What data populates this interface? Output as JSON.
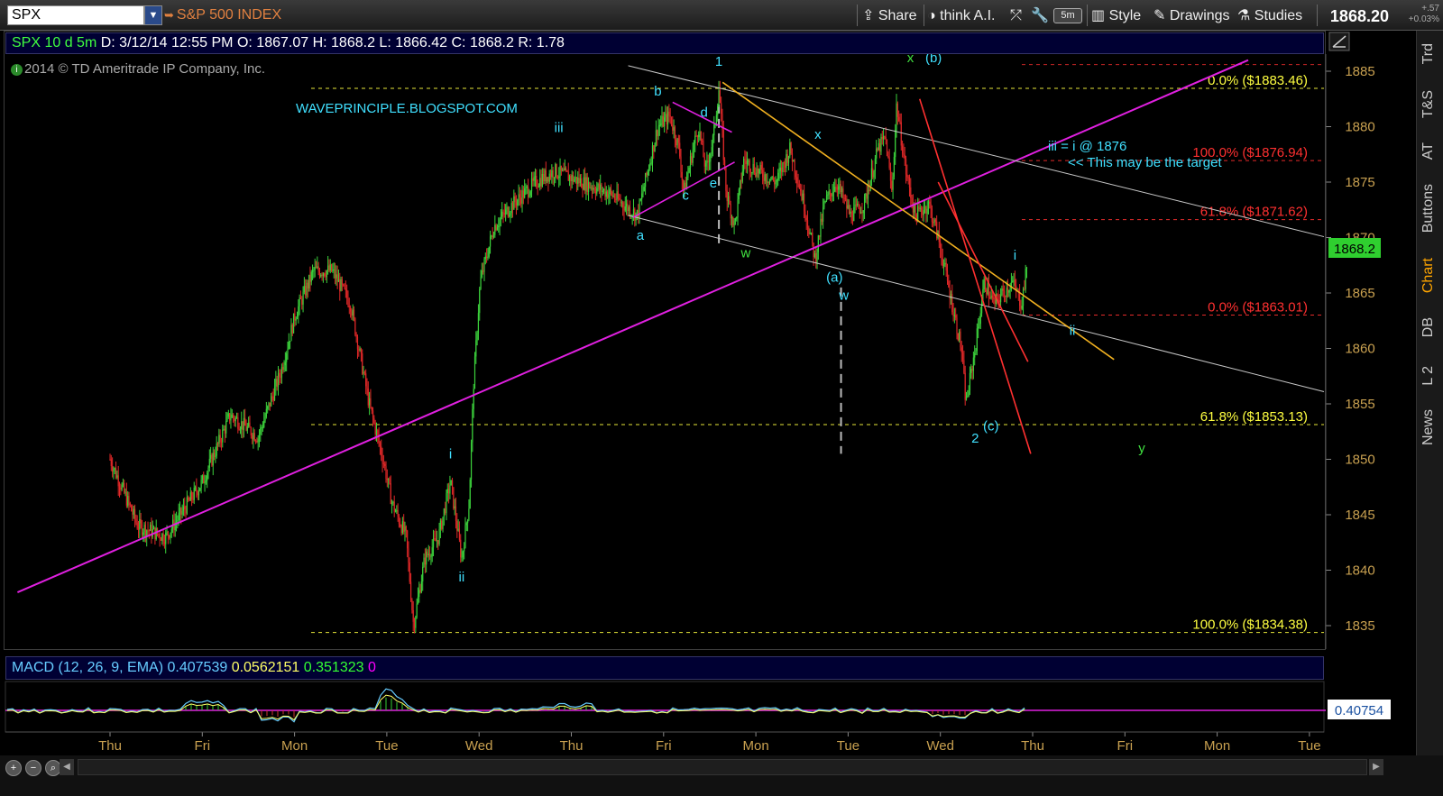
{
  "toolbar": {
    "symbol": "SPX",
    "description": "S&P 500 INDEX",
    "share": "Share",
    "think_ai": "think A.I.",
    "interval": "5m",
    "style": "Style",
    "drawings": "Drawings",
    "studies": "Studies",
    "last_price": "1868.20",
    "change": "+.57",
    "change_pct": "+0.03%"
  },
  "info": {
    "symbol_period": "SPX 10 d 5m",
    "date": "D: 3/12/14 12:55 PM",
    "open": "O: 1867.07",
    "high": "H: 1868.2",
    "low": "L: 1866.42",
    "close": "C: 1868.2",
    "range": "R: 1.78",
    "copyright": "2014 © TD Ameritrade IP Company, Inc."
  },
  "macd": {
    "label": "MACD (12, 26, 9, EMA)",
    "value": "0.407539",
    "avg": "0.0562151",
    "diff": "0.351323",
    "extra": "0",
    "last_tag": "0.40754"
  },
  "right_tabs": [
    "Trd",
    "T&S",
    "AT",
    "Buttons",
    "Chart",
    "DB",
    "L 2",
    "News"
  ],
  "colors": {
    "up": "#3cd23c",
    "down": "#e02828",
    "magenta": "#e020e0",
    "orange": "#f0b020",
    "cyan": "#40e0ff",
    "yellow_fib": "#ffff40",
    "red_fib": "#ff3030",
    "axis_text": "#c8a050"
  },
  "chart_data": [
    {
      "type": "candlestick",
      "title": "SPX 10 d 5m",
      "x_labels": [
        "Thu",
        "Fri",
        "Mon",
        "Tue",
        "Wed",
        "Thu",
        "Fri",
        "Mon",
        "Tue",
        "Wed",
        "Thu",
        "Fri",
        "Mon",
        "Tue"
      ],
      "y_ticks": [
        1835,
        1840,
        1845,
        1850,
        1855,
        1860,
        1865,
        1870,
        1875,
        1880,
        1885
      ],
      "ylim": [
        1832,
        1887
      ],
      "last_price_tag": "1868.2",
      "watermark": "WAVEPRINCIPLE.BLOGSPOT.COM",
      "path_anchors": [
        [
          0.0,
          1850
        ],
        [
          0.3,
          1844
        ],
        [
          0.6,
          1843
        ],
        [
          1.0,
          1848
        ],
        [
          1.3,
          1854
        ],
        [
          1.6,
          1852
        ],
        [
          1.85,
          1858
        ],
        [
          2.0,
          1863
        ],
        [
          2.2,
          1867
        ],
        [
          2.4,
          1867
        ],
        [
          2.6,
          1864
        ],
        [
          2.8,
          1855
        ],
        [
          2.95,
          1850
        ],
        [
          3.05,
          1846
        ],
        [
          3.2,
          1843
        ],
        [
          3.28,
          1835
        ],
        [
          3.4,
          1841
        ],
        [
          3.55,
          1843
        ],
        [
          3.68,
          1848
        ],
        [
          3.8,
          1841
        ],
        [
          3.88,
          1846
        ],
        [
          3.93,
          1857
        ],
        [
          4.0,
          1866
        ],
        [
          4.15,
          1871
        ],
        [
          4.35,
          1873
        ],
        [
          4.6,
          1875
        ],
        [
          4.8,
          1876
        ],
        [
          5.1,
          1875
        ],
        [
          5.4,
          1874
        ],
        [
          5.7,
          1872
        ],
        [
          5.92,
          1880
        ],
        [
          6.05,
          1881
        ],
        [
          6.15,
          1878
        ],
        [
          6.2,
          1874
        ],
        [
          6.3,
          1878
        ],
        [
          6.36,
          1880
        ],
        [
          6.44,
          1876
        ],
        [
          6.52,
          1879
        ],
        [
          6.58,
          1883.5
        ],
        [
          6.66,
          1874
        ],
        [
          6.75,
          1871
        ],
        [
          6.85,
          1877
        ],
        [
          7.0,
          1876
        ],
        [
          7.2,
          1875
        ],
        [
          7.35,
          1878
        ],
        [
          7.5,
          1873
        ],
        [
          7.62,
          1868
        ],
        [
          7.72,
          1873
        ],
        [
          7.85,
          1875
        ],
        [
          8.0,
          1872
        ],
        [
          8.15,
          1873
        ],
        [
          8.3,
          1878
        ],
        [
          8.38,
          1879
        ],
        [
          8.45,
          1874
        ],
        [
          8.5,
          1882
        ],
        [
          8.6,
          1876
        ],
        [
          8.7,
          1872
        ],
        [
          8.85,
          1873
        ],
        [
          8.95,
          1870
        ],
        [
          9.05,
          1866
        ],
        [
          9.2,
          1860
        ],
        [
          9.25,
          1855
        ],
        [
          9.35,
          1860
        ],
        [
          9.45,
          1866
        ],
        [
          9.55,
          1864
        ],
        [
          9.65,
          1865
        ],
        [
          9.75,
          1866
        ],
        [
          9.85,
          1864
        ],
        [
          9.92,
          1868
        ]
      ],
      "fib_levels": [
        {
          "label": "0.0%",
          "price": "($1883.46)",
          "value": 1883.46,
          "color": "yellow"
        },
        {
          "label": "100.0%",
          "price": "($1876.94)",
          "value": 1876.94,
          "color": "red"
        },
        {
          "label": "61.8%",
          "price": "($1871.62)",
          "value": 1871.62,
          "color": "red"
        },
        {
          "label": "0.0%",
          "price": "($1863.01)",
          "value": 1863.01,
          "color": "red"
        },
        {
          "label": "61.8%",
          "price": "($1853.13)",
          "value": 1853.13,
          "color": "yellow"
        },
        {
          "label": "100.0%",
          "price": "($1834.38)",
          "value": 1834.38,
          "color": "yellow"
        }
      ],
      "annotations": [
        {
          "text": "iii = i @ 1876",
          "color": "cyan"
        },
        {
          "text": "<< This may be the target",
          "color": "cyan"
        }
      ],
      "wave_labels": [
        {
          "text": "1",
          "color": "cyan",
          "t": 6.58,
          "y": 1885.5
        },
        {
          "text": "b",
          "color": "cyan",
          "t": 5.92,
          "y": 1882.8
        },
        {
          "text": "d",
          "color": "cyan",
          "t": 6.42,
          "y": 1880.9
        },
        {
          "text": "c",
          "color": "cyan",
          "t": 6.22,
          "y": 1873.4
        },
        {
          "text": "e",
          "color": "cyan",
          "t": 6.52,
          "y": 1874.5
        },
        {
          "text": "a",
          "color": "cyan",
          "t": 5.73,
          "y": 1869.8
        },
        {
          "text": "iii",
          "color": "cyan",
          "t": 4.85,
          "y": 1879.5
        },
        {
          "text": "w",
          "color": "green",
          "t": 6.87,
          "y": 1868.2
        },
        {
          "text": "x",
          "color": "cyan",
          "t": 7.65,
          "y": 1878.9
        },
        {
          "text": "(a)",
          "color": "cyan",
          "t": 7.83,
          "y": 1866.0
        },
        {
          "text": "w",
          "color": "cyan",
          "t": 7.93,
          "y": 1864.4
        },
        {
          "text": "x",
          "color": "green",
          "t": 8.65,
          "y": 1885.8
        },
        {
          "text": "(b)",
          "color": "cyan",
          "t": 8.9,
          "y": 1885.8
        },
        {
          "text": "i",
          "color": "cyan",
          "t": 9.78,
          "y": 1868.0
        },
        {
          "text": "ii",
          "color": "cyan",
          "t": 10.4,
          "y": 1861.2
        },
        {
          "text": "(c)",
          "color": "cyan",
          "t": 9.52,
          "y": 1852.6
        },
        {
          "text": "2",
          "color": "cyan",
          "t": 9.35,
          "y": 1851.5
        },
        {
          "text": "y",
          "color": "green",
          "t": 11.15,
          "y": 1850.6
        },
        {
          "text": "i",
          "color": "cyan",
          "t": 3.68,
          "y": 1850.1
        },
        {
          "text": "ii",
          "color": "cyan",
          "t": 3.8,
          "y": 1839.0
        }
      ],
      "trend_lines": [
        {
          "name": "magenta-uptrend",
          "color": "magenta",
          "from": [
            -1.0,
            1838
          ],
          "to": [
            12.3,
            1886
          ]
        },
        {
          "name": "upper-channel",
          "color": "gray",
          "from": [
            5.6,
            1885.5
          ],
          "to": [
            13.4,
            1869.5
          ]
        },
        {
          "name": "lower-channel",
          "color": "gray",
          "from": [
            5.6,
            1872
          ],
          "to": [
            13.4,
            1855.5
          ]
        },
        {
          "name": "orange-downtrend",
          "color": "orange",
          "from": [
            6.62,
            1884
          ],
          "to": [
            10.85,
            1859
          ]
        },
        {
          "name": "red-channel-a",
          "color": "red",
          "from": [
            8.75,
            1882.5
          ],
          "to": [
            9.95,
            1850.5
          ]
        },
        {
          "name": "red-channel-b",
          "color": "red",
          "from": [
            8.95,
            1875
          ],
          "to": [
            9.92,
            1858.8
          ]
        },
        {
          "name": "magenta-small",
          "color": "magenta",
          "from": [
            6.08,
            1882.2
          ],
          "to": [
            6.72,
            1879.5
          ]
        },
        {
          "name": "magenta-small-2",
          "color": "magenta",
          "from": [
            5.65,
            1871.8
          ],
          "to": [
            6.75,
            1876.8
          ]
        }
      ]
    },
    {
      "type": "line",
      "title": "MACD (12, 26, 9, EMA)",
      "series": [
        {
          "name": "MACD",
          "values": [
            0.05
          ]
        },
        {
          "name": "Avg",
          "values": [
            0.05
          ]
        }
      ]
    }
  ]
}
